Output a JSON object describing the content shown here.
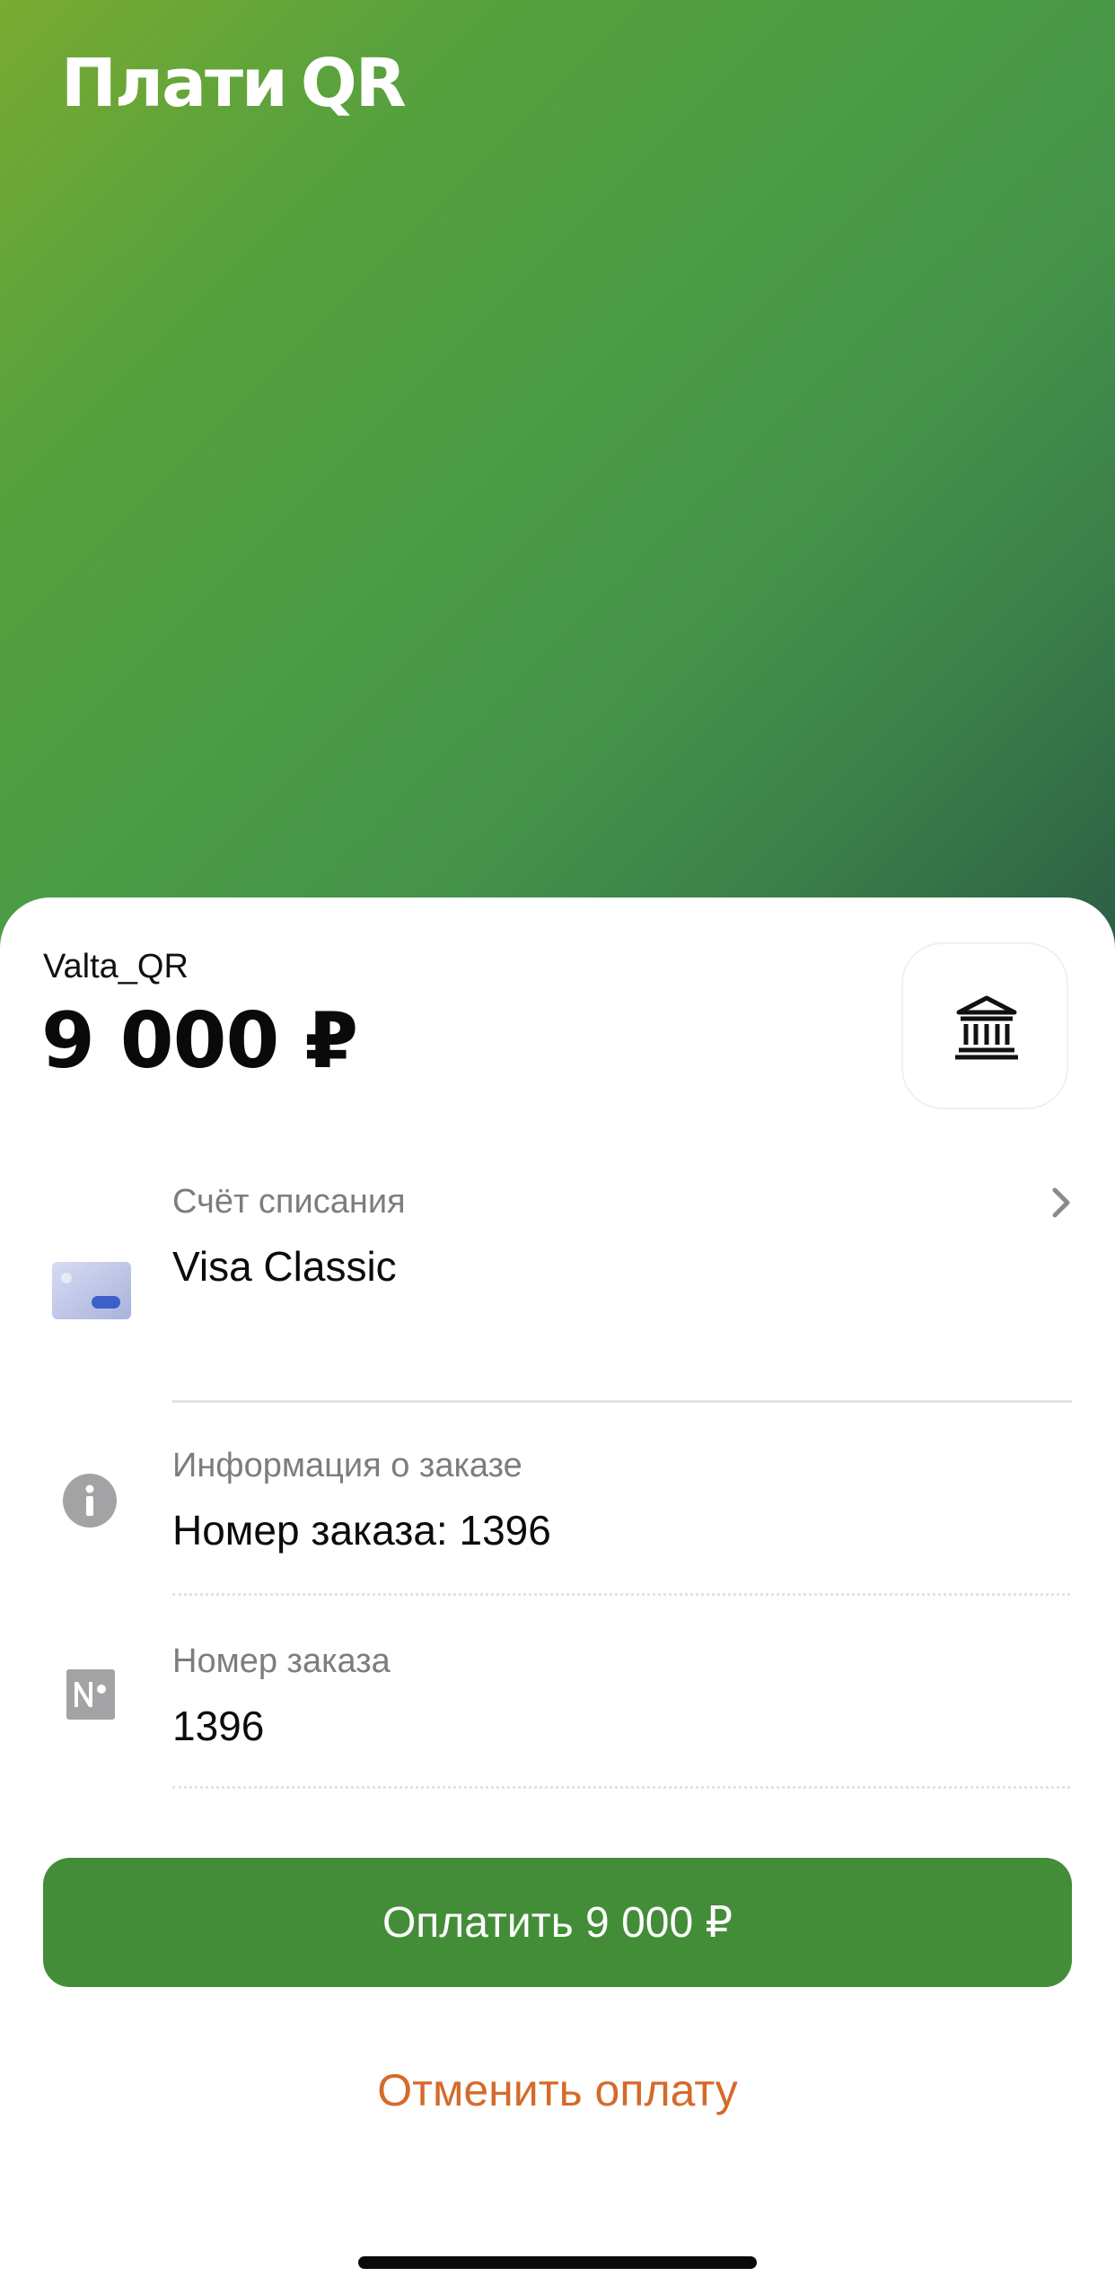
{
  "header": {
    "logo_text": "Плати",
    "logo_qr": "QR",
    "gradient_colors": [
      "#7aab32",
      "#4c9c45",
      "#2c5e44"
    ]
  },
  "payment": {
    "merchant": "Valta_QR",
    "amount": "9 000 ₽",
    "merchant_icon": "bank-building-icon"
  },
  "account": {
    "label": "Счёт списания",
    "value": "Visa Classic",
    "icon": "card-icon",
    "chevron_icon": "chevron-right-icon"
  },
  "order_info": {
    "label": "Информация о заказе",
    "value": "Номер заказа: 1396",
    "icon": "info-icon"
  },
  "order_number": {
    "label": "Номер заказа",
    "value": "1396",
    "icon": "number-sign-icon"
  },
  "actions": {
    "pay_label": "Оплатить 9 000 ₽",
    "cancel_label": "Отменить оплату",
    "accent_color": "#438d38",
    "cancel_color": "#d56a2a"
  }
}
